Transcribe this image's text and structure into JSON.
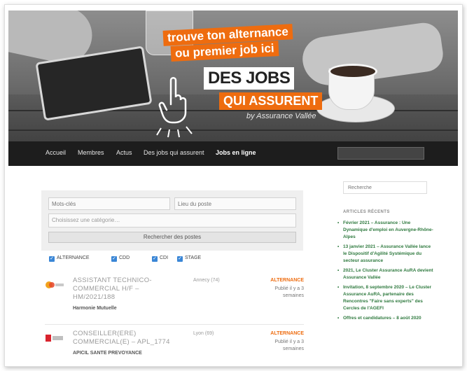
{
  "hero": {
    "tagline_line1": "trouve ton alternance",
    "tagline_line2": "ou premier job ici",
    "title": "DES JOBS",
    "subtitle": "QUI ASSURENT",
    "byline": "by Assurance Vallée"
  },
  "nav": {
    "items": [
      {
        "label": "Accueil"
      },
      {
        "label": "Membres"
      },
      {
        "label": "Actus"
      },
      {
        "label": "Des jobs qui assurent"
      },
      {
        "label": "Jobs en ligne"
      }
    ],
    "search_placeholder": ""
  },
  "search_form": {
    "keywords_placeholder": "Mots-clés",
    "location_placeholder": "Lieu du poste",
    "category_placeholder": "Choisissez une catégorie…",
    "submit_label": "Rechercher des postes",
    "filters": [
      {
        "label": "ALTERNANCE",
        "checked": true
      },
      {
        "label": "CDD",
        "checked": true
      },
      {
        "label": "CDI",
        "checked": true
      },
      {
        "label": "STAGE",
        "checked": true
      }
    ]
  },
  "jobs": [
    {
      "title": "ASSISTANT TECHNICO-COMMERCIAL H/F – HM/2021/188",
      "company": "Harmonie Mutuelle",
      "location": "Annecy (74)",
      "type": "ALTERNANCE",
      "posted": "Publié il y a 3 semaines",
      "logo": "harmonie-logo"
    },
    {
      "title": "CONSEILLER(ERE) COMMERCIAL(E) – APL_1774",
      "company": "APICIL SANTE PREVOYANCE",
      "location": "Lyon (69)",
      "type": "ALTERNANCE",
      "posted": "Publié il y a 3 semaines",
      "logo": "apicil-logo"
    }
  ],
  "sidebar": {
    "search_placeholder": "Recherche",
    "recent_heading": "ARTICLES RÉCENTS",
    "recent": [
      "Février 2021 – Assurance : Une Dynamique d'emploi en Auvergne-Rhône-Alpes",
      "13 janvier 2021 – Assurance Vallée lance le Dispositif d'Agilité Systémique du secteur assurance",
      "2021, Le Cluster Assurance AuRA devient Assurance Vallée",
      "Invitation, 8 septembre 2020 – Le Cluster Assurance AuRA, partenaire des Rencontres \"Faire sans experts\" des Cercles de l'AGEFI",
      "Offres et candidatures – 8 août 2020"
    ]
  },
  "colors": {
    "accent": "#ee6c0f",
    "nav_bg": "#1d1d1d",
    "sidebar_link": "#2f7a3f",
    "checkbox": "#3a86d6"
  }
}
